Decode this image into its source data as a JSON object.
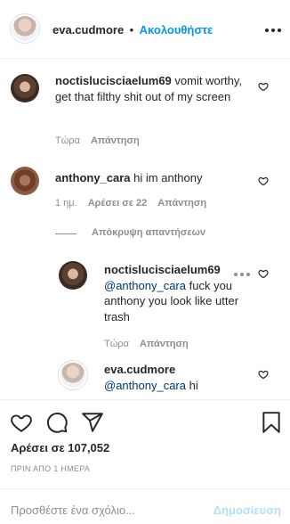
{
  "header": {
    "username": "eva.cudmore",
    "separator": "•",
    "follow_label": "Ακολουθήστε"
  },
  "comments": [
    {
      "username": "noctislucisciaelum69",
      "text": "vomit worthy, get that filthy shit out of my screen",
      "time": "Τώρα",
      "reply_label": "Απάντηση"
    },
    {
      "username": "anthony_cara",
      "text": "hi im anthony",
      "time": "1 ημ.",
      "likes_label": "Αρέσει σε 22",
      "reply_label": "Απάντηση",
      "hide_replies_label": "Απόκρυψη απαντήσεων",
      "replies": [
        {
          "username": "noctislucisciaelum69",
          "mention": "@anthony_cara",
          "text": "fuck you anthony you look like utter trash",
          "time": "Τώρα",
          "reply_label": "Απάντηση"
        },
        {
          "username": "eva.cudmore",
          "mention": "@anthony_cara",
          "text": "hi"
        }
      ]
    }
  ],
  "footer": {
    "likes": "Αρέσει σε 107,052",
    "posted_ago": "ΠΡΙΝ ΑΠΟ 1 ΗΜΕΡΑ",
    "comment_placeholder": "Προσθέστε ένα σχόλιο...",
    "post_label": "Δημοσίευση"
  },
  "colors": {
    "accent": "#0095f6",
    "mention": "#00376b",
    "muted": "#8e8e8e",
    "post_disabled": "#b2dffc"
  },
  "icons": [
    "more-icon",
    "heart-icon",
    "comment-icon",
    "share-icon",
    "bookmark-icon"
  ]
}
